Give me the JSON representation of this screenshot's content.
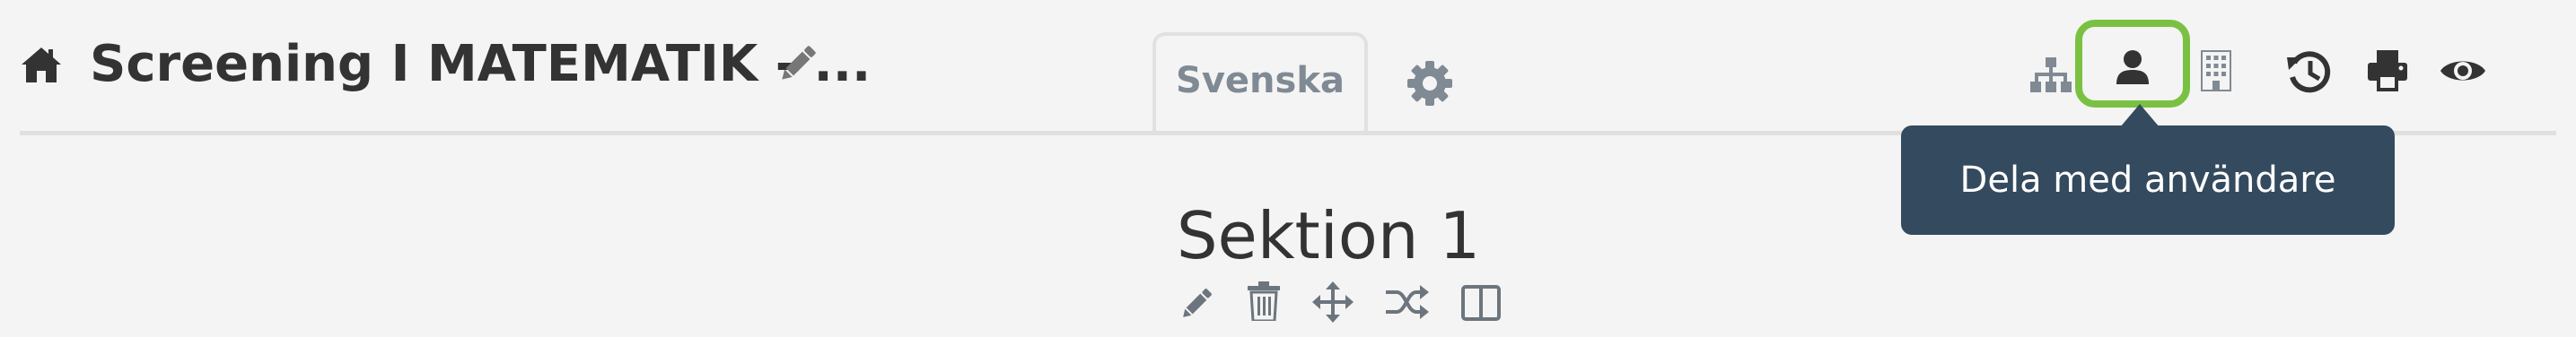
{
  "header": {
    "title": "Screening I MATEMATIK - ...",
    "icons": [
      "home-icon",
      "pencil-icon"
    ]
  },
  "tabs": {
    "active_language": "Svenska",
    "settings_icon": "gear-icon"
  },
  "toolbar": {
    "items": [
      "hierarchy-icon",
      "user-icon",
      "building-icon",
      "history-icon",
      "print-icon",
      "eye-icon"
    ],
    "highlight_color": "#7ac143"
  },
  "tooltip": {
    "text": "Dela med användare",
    "background": "#344a5e"
  },
  "section": {
    "title": "Sektion 1",
    "actions": [
      "pencil-icon",
      "trash-icon",
      "move-icon",
      "shuffle-icon",
      "columns-icon"
    ]
  }
}
